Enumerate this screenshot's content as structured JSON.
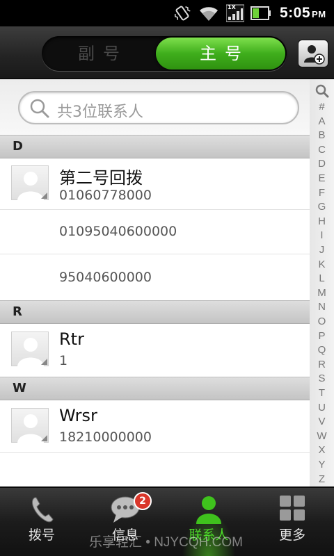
{
  "status_bar": {
    "time": "5:05",
    "ampm": "PM",
    "signal_label": "1X",
    "icons": [
      "vibrate-icon",
      "wifi-icon",
      "signal-icon",
      "battery-icon"
    ]
  },
  "header": {
    "segment_secondary": "副号",
    "segment_primary": "主号",
    "add_contact_icon": "add-contact-icon"
  },
  "search": {
    "placeholder": "共3位联系人"
  },
  "sections": [
    {
      "letter": "D",
      "contacts": [
        {
          "name": "第二号回拨",
          "numbers": [
            "01060778000",
            "01095040600000",
            "95040600000"
          ]
        }
      ]
    },
    {
      "letter": "R",
      "contacts": [
        {
          "name": "Rtr",
          "numbers": [
            "1"
          ]
        }
      ]
    },
    {
      "letter": "W",
      "contacts": [
        {
          "name": "Wrsr",
          "numbers": [
            "18210000000"
          ]
        }
      ]
    }
  ],
  "index_bar": [
    "#",
    "A",
    "B",
    "C",
    "D",
    "E",
    "F",
    "G",
    "H",
    "I",
    "J",
    "K",
    "L",
    "M",
    "N",
    "O",
    "P",
    "Q",
    "R",
    "S",
    "T",
    "U",
    "V",
    "W",
    "X",
    "Y",
    "Z"
  ],
  "tabbar": {
    "tabs": [
      {
        "label": "拨号",
        "icon": "phone-icon"
      },
      {
        "label": "信息",
        "icon": "message-icon",
        "badge": "2"
      },
      {
        "label": "联系人",
        "icon": "contacts-icon",
        "active": true
      },
      {
        "label": "更多",
        "icon": "more-grid-icon"
      }
    ]
  },
  "watermark": "乐享轻汇 • NJYCQH.COM",
  "colors": {
    "accent_green": "#4dd92a",
    "badge_red": "#d9362a"
  }
}
